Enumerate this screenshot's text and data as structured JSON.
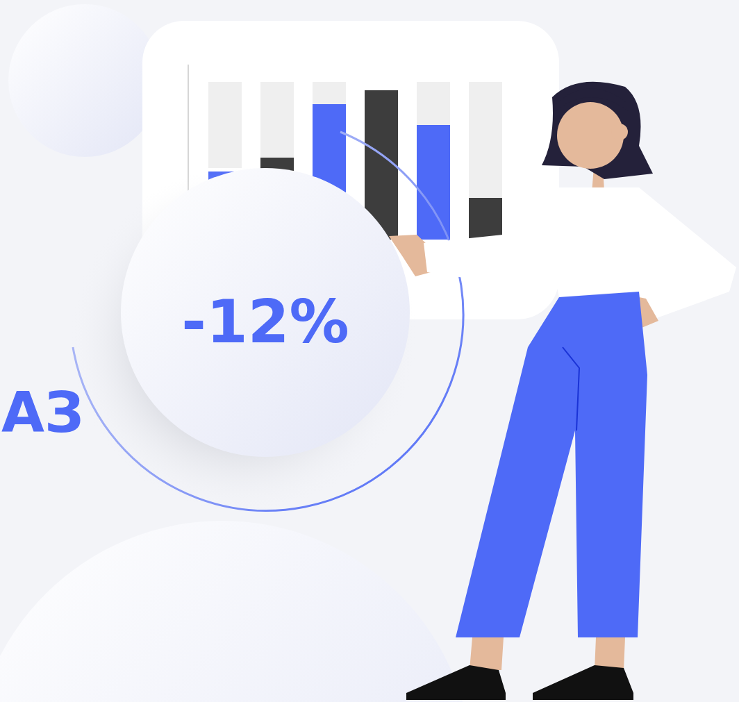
{
  "badge": {
    "text": "-12%"
  },
  "heading": {
    "text": "АЗ"
  }
}
